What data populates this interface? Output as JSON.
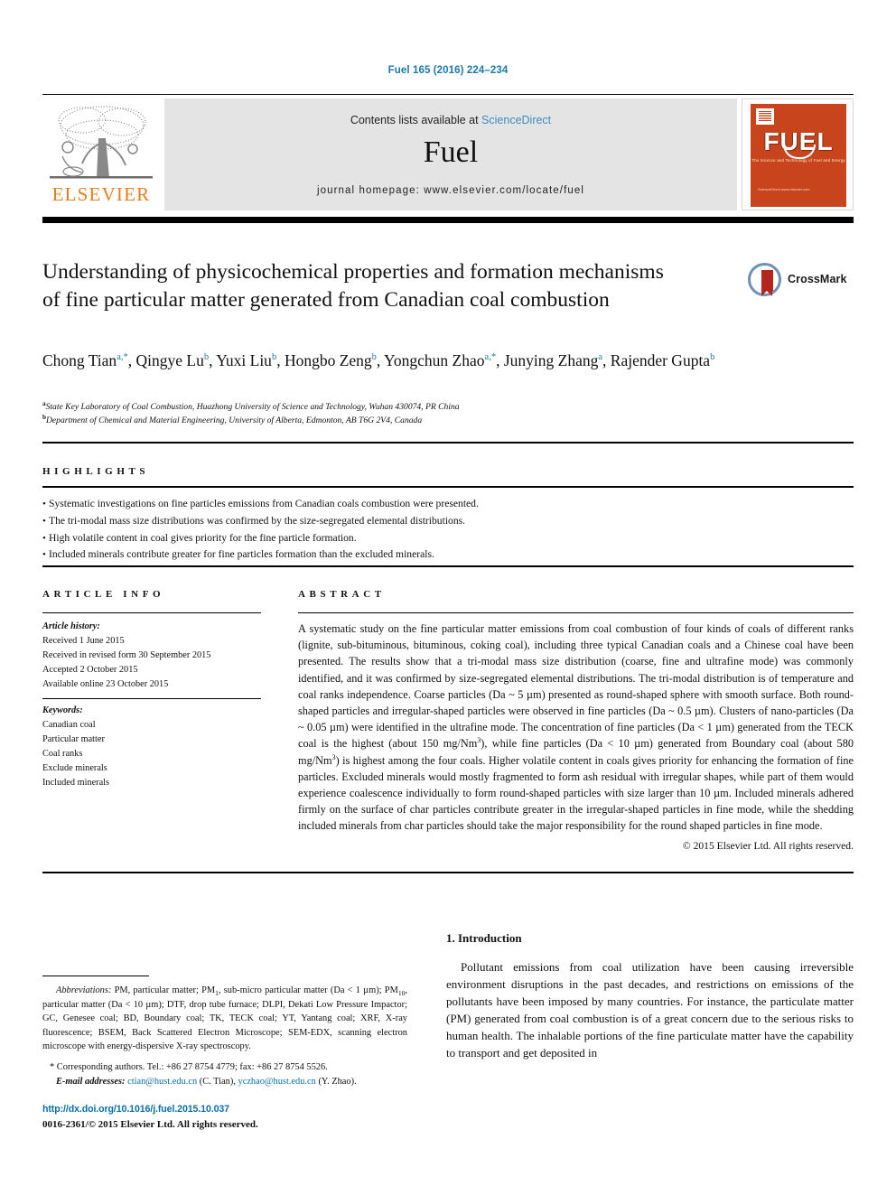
{
  "running_head": "Fuel 165 (2016) 224–234",
  "masthead": {
    "publisher_logo_name": "elsevier-tree-logo",
    "publisher_wordmark": "ELSEVIER",
    "contents_prefix": "Contents lists available at ",
    "contents_link": "ScienceDirect",
    "journal_title": "Fuel",
    "homepage": "journal homepage: www.elsevier.com/locate/fuel",
    "cover": {
      "title": "FUEL",
      "subtitle": "The Science and Technology of Fuel and Energy",
      "footer": "ScienceDirect\nwww.elsevier.com"
    }
  },
  "article": {
    "title": "Understanding of physicochemical properties and formation mechanisms of fine particular matter generated from Canadian coal combustion",
    "crossmark_label": "CrossMark",
    "authors_line_1": "Chong Tian a,*, Qingye Lu b, Yuxi Liu b, Hongbo Zeng b, Yongchun Zhao a,*, Junying Zhang a,",
    "authors_line_2": "Rajender Gupta b",
    "authors": [
      {
        "name": "Chong Tian",
        "sup": "a,*"
      },
      {
        "name": "Qingye Lu",
        "sup": "b"
      },
      {
        "name": "Yuxi Liu",
        "sup": "b"
      },
      {
        "name": "Hongbo Zeng",
        "sup": "b"
      },
      {
        "name": "Yongchun Zhao",
        "sup": "a,*"
      },
      {
        "name": "Junying Zhang",
        "sup": "a"
      },
      {
        "name": "Rajender Gupta",
        "sup": "b"
      }
    ],
    "affiliations": [
      {
        "sup": "a",
        "text": "State Key Laboratory of Coal Combustion, Huazhong University of Science and Technology, Wuhan 430074, PR China"
      },
      {
        "sup": "b",
        "text": "Department of Chemical and Material Engineering, University of Alberta, Edmonton, AB T6G 2V4, Canada"
      }
    ]
  },
  "highlights": {
    "heading": "HIGHLIGHTS",
    "items": [
      "Systematic investigations on fine particles emissions from Canadian coals combustion were presented.",
      "The tri-modal mass size distributions was confirmed by the size-segregated elemental distributions.",
      "High volatile content in coal gives priority for the fine particle formation.",
      "Included minerals contribute greater for fine particles formation than the excluded minerals."
    ]
  },
  "article_info": {
    "heading": "ARTICLE INFO",
    "history_label": "Article history:",
    "history": [
      "Received 1 June 2015",
      "Received in revised form 30 September 2015",
      "Accepted 2 October 2015",
      "Available online 23 October 2015"
    ],
    "keywords_label": "Keywords:",
    "keywords": [
      "Canadian coal",
      "Particular matter",
      "Coal ranks",
      "Exclude minerals",
      "Included minerals"
    ]
  },
  "abstract": {
    "heading": "ABSTRACT",
    "text_part_1": "A systematic study on the fine particular matter emissions from coal combustion of four kinds of coals of different ranks (lignite, sub-bituminous, bituminous, coking coal), including three typical Canadian coals and a Chinese coal have been presented. The results show that a tri-modal mass size distribution (coarse, fine and ultrafine mode) was commonly identified, and it was confirmed by size-segregated elemental distributions. The tri-modal distribution is of temperature and coal ranks independence. Coarse particles (Da ~ 5 µm) presented as round-shaped sphere with smooth surface. Both round-shaped particles and irregular-shaped particles were observed in fine particles (Da ~ 0.5 µm). Clusters of nano-particles (Da ~ 0.05 µm) were identified in the ultrafine mode. The concentration of fine particles (Da < 1 µm) generated from the TECK coal is the highest (about 150 mg/Nm",
    "sup_1": "3",
    "text_part_2": "), while fine particles (Da < 10 µm) generated from Boundary coal (about 580 mg/Nm",
    "sup_2": "3",
    "text_part_3": ") is highest among the four coals. Higher volatile content in coals gives priority for enhancing the formation of fine particles. Excluded minerals would mostly fragmented to form ash residual with irregular shapes, while part of them would experience coalescence individually to form round-shaped particles with size larger than 10 µm. Included minerals adhered firmly on the surface of char particles contribute greater in the irregular-shaped particles in fine mode, while the shedding included minerals from char particles should take the major responsibility for the round shaped particles in fine mode.",
    "copyright": "© 2015 Elsevier Ltd. All rights reserved."
  },
  "introduction": {
    "heading": "1. Introduction",
    "paragraph": "Pollutant emissions from coal utilization have been causing irreversible environment disruptions in the past decades, and restrictions on emissions of the pollutants have been imposed by many countries. For instance, the particulate matter (PM) generated from coal combustion is of a great concern due to the serious risks to human health. The inhalable portions of the fine particulate matter have the capability to transport and get deposited in"
  },
  "footnotes": {
    "abbrev_label": "Abbreviations:",
    "abbrev_a": " PM, particular matter; PM",
    "abbrev_sub1": "1",
    "abbrev_b": ", sub-micro particular matter (Da < 1 µm); PM",
    "abbrev_sub2": "10",
    "abbrev_c": ", particular matter (Da < 10 µm); DTF, drop tube furnace; DLPI, Dekati Low Pressure Impactor; GC, Genesee coal; BD, Boundary coal; TK, TECK coal; YT, Yantang coal; XRF, X-ray fluorescence; BSEM, Back Scattered Electron Microscope; SEM-EDX, scanning electron microscope with energy-dispersive X-ray spectroscopy.",
    "corresponding": "* Corresponding authors. Tel.: +86 27 8754 4779; fax: +86 27 8754 5526.",
    "email_label": "E-mail addresses:",
    "email_1": "ctian@hust.edu.cn",
    "email_1_suffix": " (C. Tian), ",
    "email_2": "yczhao@hust.edu.cn",
    "email_2_suffix": " (Y. Zhao).",
    "doi": "http://dx.doi.org/10.1016/j.fuel.2015.10.037",
    "issn": "0016-2361/© 2015 Elsevier Ltd. All rights reserved."
  },
  "colors": {
    "link_blue": "#1b7aa8",
    "sciencedirect_blue": "#3d8cc4",
    "elsevier_orange": "#e87d1e",
    "cover_orange": "#c8441c",
    "crossmark_red": "#b5251c",
    "crossmark_ring": "#6e90b8"
  }
}
